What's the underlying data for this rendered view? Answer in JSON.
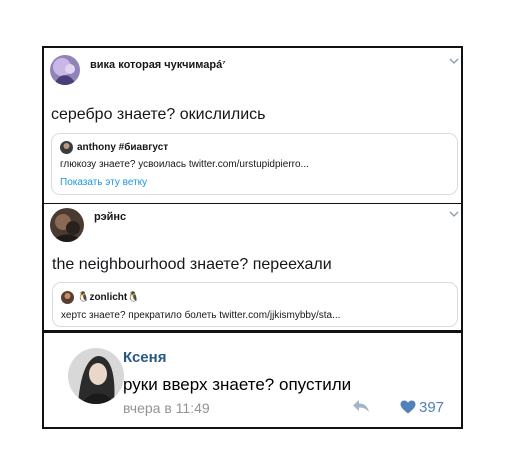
{
  "tweet1": {
    "author": "вика которая чукчимарá",
    "author_suffix": "⁷",
    "text": "серебро знаете? окислились",
    "quote": {
      "author": "anthony #биавгуст",
      "text": "глюкозу знаете? усвоилась twitter.com/urstupidpierro...",
      "show_thread": "Показать эту ветку"
    }
  },
  "tweet2": {
    "author": "рэйнс",
    "text": "the neighbourhood знаете? переехали",
    "quote": {
      "author": "🐧zonlicht🐧",
      "text": "хертс знаете? прекратило болеть twitter.com/jjkismybby/sta..."
    }
  },
  "vk_post": {
    "author": "Ксеня",
    "text": "руки вверх знаете? опустили",
    "time": "вчера в 11:49",
    "likes": "397"
  },
  "colors": {
    "vk_blue": "#5181b8",
    "vk_name": "#2a5885",
    "twitter_link": "#1b95e0"
  }
}
